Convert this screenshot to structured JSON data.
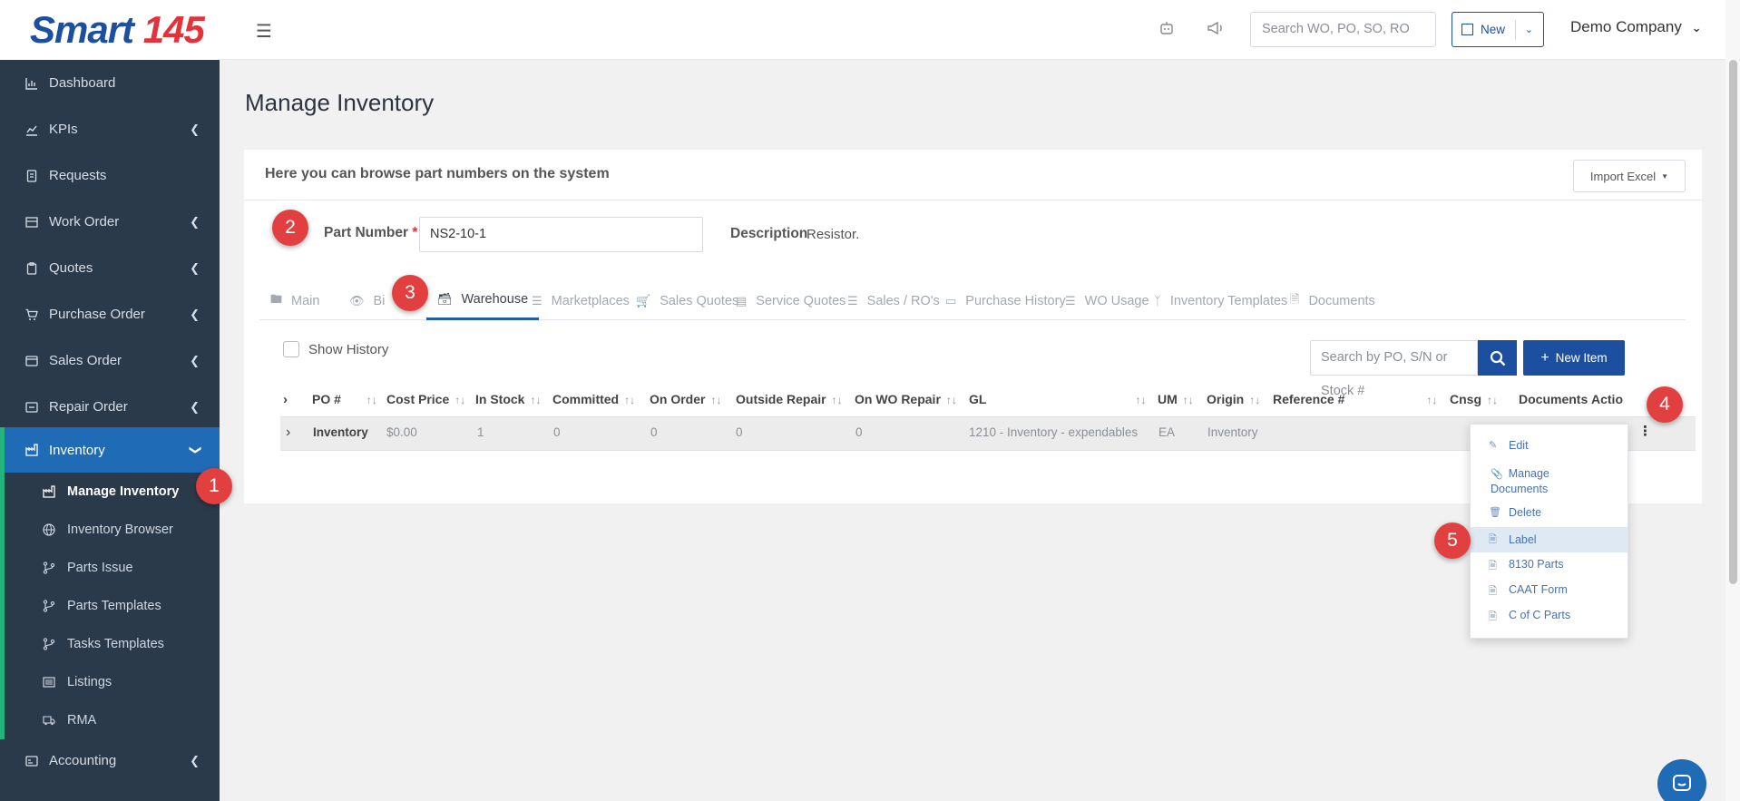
{
  "app": {
    "logo_text": "Smart",
    "logo_accent": "145"
  },
  "topbar": {
    "search_placeholder": "Search WO, PO, SO, RO",
    "new_label": "New",
    "company": "Demo Company"
  },
  "sidebar": {
    "items": [
      {
        "label": "Dashboard",
        "icon": "chart-icon"
      },
      {
        "label": "KPIs",
        "icon": "kpi-icon"
      },
      {
        "label": "Requests",
        "icon": "request-icon"
      },
      {
        "label": "Work Order",
        "icon": "work-order-icon"
      },
      {
        "label": "Quotes",
        "icon": "quote-icon"
      },
      {
        "label": "Purchase Order",
        "icon": "cart-icon"
      },
      {
        "label": "Sales Order",
        "icon": "sales-icon"
      },
      {
        "label": "Repair Order",
        "icon": "repair-icon"
      },
      {
        "label": "Inventory",
        "icon": "inventory-icon"
      },
      {
        "label": "Accounting",
        "icon": "accounting-icon"
      }
    ],
    "inventory_sub": [
      {
        "label": "Manage Inventory"
      },
      {
        "label": "Inventory Browser"
      },
      {
        "label": "Parts Issue"
      },
      {
        "label": "Parts Templates"
      },
      {
        "label": "Tasks Templates"
      },
      {
        "label": "Listings"
      },
      {
        "label": "RMA"
      }
    ]
  },
  "page": {
    "title": "Manage Inventory",
    "card_header": "Here you can browse part numbers on the system",
    "import_label": "Import Excel",
    "part_number_label": "Part Number",
    "required_mark": "*",
    "part_number_value": "NS2-10-1",
    "description_label": "Description",
    "description_value": "Resistor."
  },
  "tabs": [
    {
      "label": "Main"
    },
    {
      "label": "Bi"
    },
    {
      "label": "Warehouse"
    },
    {
      "label": "Marketplaces"
    },
    {
      "label": "Sales Quotes"
    },
    {
      "label": "Service Quotes"
    },
    {
      "label": "Sales / RO's"
    },
    {
      "label": "Purchase History"
    },
    {
      "label": "WO Usage"
    },
    {
      "label": "Inventory Templates"
    },
    {
      "label": "Documents"
    }
  ],
  "warehouse": {
    "show_history": "Show History",
    "search_placeholder": "Search by PO, S/N or Stock #",
    "new_item": "New Item",
    "columns": [
      "PO #",
      "Cost Price",
      "In Stock",
      "Committed",
      "On Order",
      "Outside Repair",
      "On WO Repair",
      "GL",
      "UM",
      "Origin",
      "Reference #",
      "Cnsg",
      "Documents",
      "Actio"
    ],
    "row": {
      "po": "Inventory",
      "cost": "$0.00",
      "in_stock": "1",
      "committed": "0",
      "on_order": "0",
      "outside_repair": "0",
      "wo_repair": "0",
      "gl": "1210 - Inventory - expendables",
      "um": "EA",
      "origin": "Inventory"
    }
  },
  "actions_menu": [
    {
      "label": "Edit"
    },
    {
      "label": "Manage Documents"
    },
    {
      "label": "Delete"
    },
    {
      "label": "Label"
    },
    {
      "label": "8130 Parts"
    },
    {
      "label": "CAAT Form"
    },
    {
      "label": "C of C Parts"
    }
  ],
  "steps": [
    "1",
    "2",
    "3",
    "4",
    "5"
  ],
  "colors": {
    "sidebar": "#2b3a4b",
    "primary": "#1c4fa0",
    "active_nav": "#1f6bb5",
    "badge": "#e24040",
    "accent_green": "#21b57b"
  }
}
